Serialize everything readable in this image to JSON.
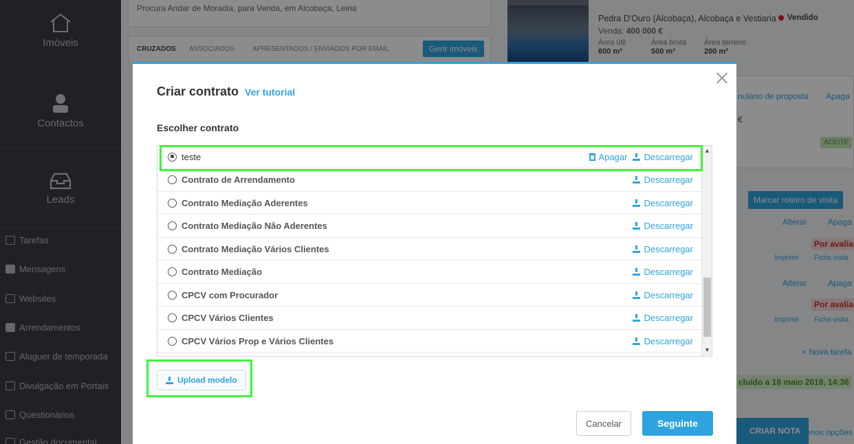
{
  "sidebar": {
    "main_items": [
      {
        "label": "Imóveis",
        "icon": "house-icon"
      },
      {
        "label": "Contactos",
        "icon": "person-icon"
      },
      {
        "label": "Leads",
        "icon": "inbox-icon"
      }
    ],
    "items": [
      {
        "label": "Tarefas",
        "icon": "checkbox-icon"
      },
      {
        "label": "Mensagens",
        "icon": "envelope-icon"
      },
      {
        "label": "Websites",
        "icon": "website-icon"
      },
      {
        "label": "Arrendamentos",
        "icon": "key-icon"
      },
      {
        "label": "Aluguer de temporada",
        "icon": "calendar-icon"
      },
      {
        "label": "Divulgação em Portais",
        "icon": "portal-icon"
      },
      {
        "label": "Questionários",
        "icon": "form-icon"
      },
      {
        "label": "Gestão documental",
        "icon": "document-icon"
      }
    ]
  },
  "background": {
    "search_text": "Procura Andar de Moradia, para Venda, em Alcobaça, Leiria",
    "tabs": [
      "CRUZADOS",
      "ASSOCIADOS",
      "APRESENTADOS / ENVIADOS POR EMAIL"
    ],
    "manage_button": "Gerir imóveis",
    "property": {
      "location": "Pedra D'Ouro (Alcobaça), Alcobaça e Vestiaria",
      "status": "Vendido",
      "status_color": "#e02424",
      "price_label": "Venda:",
      "price": "400 000 €",
      "areas": [
        {
          "label": "Área útil",
          "value": "600 m²"
        },
        {
          "label": "Área bruta",
          "value": "500 m²"
        },
        {
          "label": "Área terreno",
          "value": "200 m²"
        }
      ]
    },
    "proposal_link": "nulário de proposta",
    "delete_link": "Apaga",
    "euro": "€",
    "accepted_badge": "ACEITE",
    "visit_button": "Marcar roteiro de visita",
    "edit_link": "Alterar",
    "evaluate_badge": "Por avaliar",
    "print_link": "Imprimir",
    "visit_sheet_link": "Ficha visita",
    "new_task": "+ Nova tarefa",
    "concluded": "cluído a 18 maio 2018, 14:36",
    "create_note": "CRIAR NOTA",
    "fewer_options": "Menos opções"
  },
  "modal": {
    "title": "Criar contrato",
    "tutorial_link": "Ver tutorial",
    "subtitle": "Escolher contrato",
    "delete_label": "Apagar",
    "download_label": "Descarregar",
    "contracts": [
      {
        "name": "teste",
        "selected": true,
        "deletable": true
      },
      {
        "name": "Contrato de Arrendamento",
        "selected": false,
        "deletable": false
      },
      {
        "name": "Contrato Mediação Aderentes",
        "selected": false,
        "deletable": false
      },
      {
        "name": "Contrato Mediação Não Aderentes",
        "selected": false,
        "deletable": false
      },
      {
        "name": "Contrato Mediação Vários Clientes",
        "selected": false,
        "deletable": false
      },
      {
        "name": "Contrato Mediação",
        "selected": false,
        "deletable": false
      },
      {
        "name": "CPCV com Procurador",
        "selected": false,
        "deletable": false
      },
      {
        "name": "CPCV Vários Clientes",
        "selected": false,
        "deletable": false
      },
      {
        "name": "CPCV Vários Prop e Vários Clientes",
        "selected": false,
        "deletable": false
      }
    ],
    "upload_button": "Upload modelo",
    "cancel_button": "Cancelar",
    "next_button": "Seguinte"
  },
  "colors": {
    "accent": "#2ea3dd",
    "highlight": "#3cf53c",
    "sidebar": "#3a3d42"
  }
}
